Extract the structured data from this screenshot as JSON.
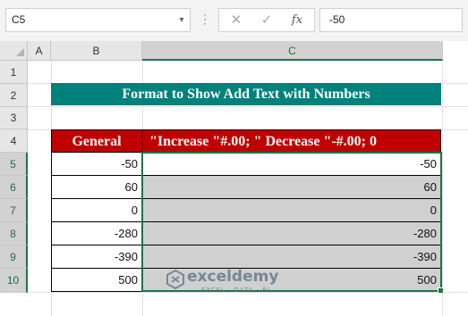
{
  "formula_bar": {
    "name_box": "C5",
    "cancel_icon": "✕",
    "enter_icon": "✓",
    "fx_label": "fx",
    "formula_value": "-50"
  },
  "columns": [
    "A",
    "B",
    "C"
  ],
  "rows": [
    "1",
    "2",
    "3",
    "4",
    "5",
    "6",
    "7",
    "8",
    "9",
    "10"
  ],
  "title": "Format to Show Add Text with Numbers",
  "table": {
    "headers": [
      "General",
      "\"Increase \"#.00; \" Decrease \"-#.00; 0"
    ],
    "rows": [
      [
        "-50",
        "-50"
      ],
      [
        "60",
        "60"
      ],
      [
        "0",
        "0"
      ],
      [
        "-280",
        "-280"
      ],
      [
        "-390",
        "-390"
      ],
      [
        "500",
        "500"
      ]
    ]
  },
  "watermark": {
    "name": "exceldemy",
    "tagline": "EXCEL · DATA · BI"
  },
  "colors": {
    "title_bg": "#00817c",
    "header_bg": "#c00000",
    "selection": "#217346",
    "shaded_cell": "#d0d0d0"
  }
}
